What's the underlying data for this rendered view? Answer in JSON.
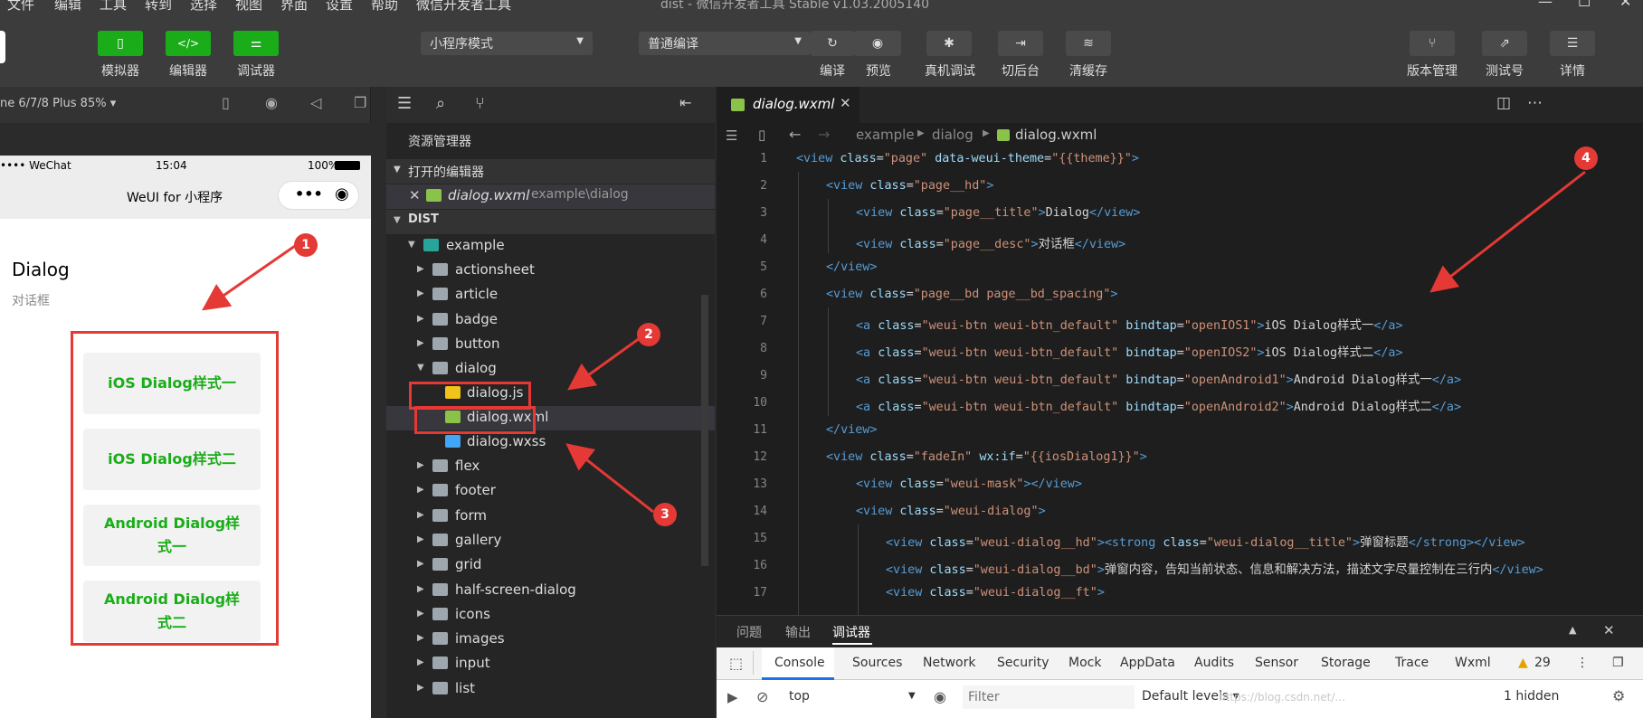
{
  "menu": {
    "items": [
      "文件",
      "编辑",
      "工具",
      "转到",
      "选择",
      "视图",
      "界面",
      "设置",
      "帮助",
      "微信开发者工具"
    ],
    "window_title": "dist - 微信开发者工具 Stable v1.03.2005140"
  },
  "toolbar": {
    "simulator": "模拟器",
    "editor": "编辑器",
    "debugger": "调试器",
    "mode_select": "小程序模式",
    "compile_select": "普通编译",
    "compile": "编译",
    "preview": "预览",
    "remote_debug": "真机调试",
    "background": "切后台",
    "clear_cache": "清缓存",
    "version": "版本管理",
    "test": "测试号",
    "details": "详情"
  },
  "simulator": {
    "device": "ne 6/7/8 Plus 85% ▾",
    "status": {
      "carrier": "•••• WeChat",
      "time": "15:04",
      "battery": "100%"
    },
    "nav_title": "WeUI for 小程序",
    "page_title": "Dialog",
    "page_desc": "对话框",
    "buttons": [
      "iOS Dialog样式一",
      "iOS Dialog样式二",
      "Android Dialog样式一",
      "Android Dialog样式二"
    ]
  },
  "explorer": {
    "title": "资源管理器",
    "open_editors": "打开的编辑器",
    "open_file": "dialog.wxml",
    "open_file_path": "example\\dialog",
    "root": "DIST",
    "example": "example",
    "folders_before": [
      "actionsheet",
      "article",
      "badge",
      "button"
    ],
    "dialog": "dialog",
    "dialog_files": [
      "dialog.js",
      "dialog.wxml",
      "dialog.wxss"
    ],
    "folders_after": [
      "flex",
      "footer",
      "form",
      "gallery",
      "grid",
      "half-screen-dialog",
      "icons",
      "images",
      "input",
      "list"
    ]
  },
  "editor": {
    "tab": "dialog.wxml",
    "breadcrumb": [
      "example",
      "dialog",
      "dialog.wxml"
    ],
    "line_numbers": [
      "1",
      "2",
      "3",
      "4",
      "5",
      "6",
      "7",
      "8",
      "9",
      "10",
      "11",
      "12",
      "13",
      "14",
      "15",
      "16",
      "17"
    ]
  },
  "devtools": {
    "panel_tabs": [
      "问题",
      "输出",
      "调试器"
    ],
    "tabs": [
      "Console",
      "Sources",
      "Network",
      "Security",
      "Mock",
      "AppData",
      "Audits",
      "Sensor",
      "Storage",
      "Trace",
      "Wxml"
    ],
    "warnings": "29",
    "context": "top",
    "filter_placeholder": "Filter",
    "levels": "Default levels ▾",
    "hidden": "1 hidden",
    "watermark": "https://blog.csdn.net/..."
  },
  "markers": [
    "1",
    "2",
    "3",
    "4"
  ],
  "colors": {
    "accent_green": "#1aad19",
    "annotation_red": "#e53935"
  }
}
